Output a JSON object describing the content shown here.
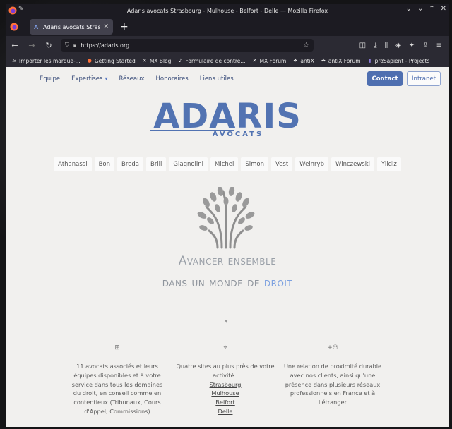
{
  "window": {
    "title": "Adaris avocats Strasbourg - Mulhouse - Belfort - Delle — Mozilla Firefox"
  },
  "tab": {
    "label": "Adaris avocats Strasbourg",
    "favicon": "A"
  },
  "urlbar": {
    "url": "https://adaris.org"
  },
  "bookmarks": [
    {
      "label": "Importer les marque-...",
      "icon": "import-icon"
    },
    {
      "label": "Getting Started",
      "icon": "firefox-icon"
    },
    {
      "label": "MX Blog",
      "icon": "mx-icon"
    },
    {
      "label": "Formulaire de contre...",
      "icon": "tiktok-icon"
    },
    {
      "label": "MX Forum",
      "icon": "mx-icon"
    },
    {
      "label": "antiX",
      "icon": "antix-icon"
    },
    {
      "label": "antiX Forum",
      "icon": "antix-icon"
    },
    {
      "label": "proSapient - Projects",
      "icon": "prosapient-icon"
    }
  ],
  "site": {
    "nav": {
      "equipe": "Equipe",
      "expertises": "Expertises",
      "reseaux": "Réseaux",
      "honoraires": "Honoraires",
      "liens": "Liens utiles",
      "contact": "Contact",
      "intranet": "Intranet"
    },
    "logo": {
      "main": "ADARIS",
      "sub": "AVOCATS"
    },
    "people": [
      "Athanassi",
      "Bon",
      "Breda",
      "Brill",
      "Giagnolini",
      "Michel",
      "Simon",
      "Vest",
      "Weinryb",
      "Winczewski",
      "Yildiz"
    ],
    "tagline": {
      "line1": "Avancer ensemble",
      "line2_prefix": "dans un monde de",
      "line2_accent": "droit"
    },
    "columns": [
      {
        "icon": "org-chart-icon",
        "text": "11 avocats associés et leurs équipes disponibles et à votre service dans tous les domaines du droit, en conseil comme en contentieux (Tribunaux, Cours d'Appel, Commissions)"
      },
      {
        "icon": "location-pin-icon",
        "text": "Quatre sites au plus près de votre activité :",
        "links": [
          "Strasbourg",
          "Mulhouse",
          "Belfort",
          "Delle"
        ]
      },
      {
        "icon": "add-people-icon",
        "text": "Une relation de proximité durable avec nos clients, ainsi qu'une présence dans plusieurs réseaux professionnels en France et à l'étranger"
      }
    ]
  },
  "colors": {
    "brand_blue": "#5273b2",
    "accent_light_blue": "#7ea2e0"
  }
}
